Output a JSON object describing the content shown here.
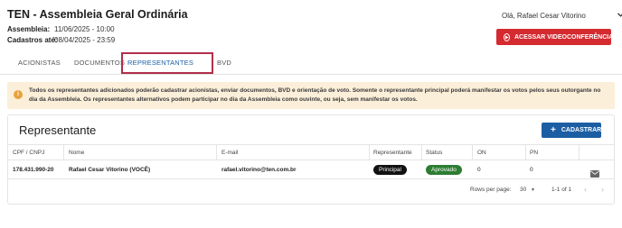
{
  "header": {
    "title": "TEN - Assembleia Geral Ordinária",
    "assembly_label": "Assembleia:",
    "assembly_value": "11/06/2025 - 10:00",
    "registrations_label": "Cadastros até:",
    "registrations_value": "08/04/2025 - 23:59",
    "greeting": "Olá, Rafael Cesar Vitorino",
    "video_button": "ACESSAR VIDEOCONFERÊNCIA"
  },
  "tabs": [
    {
      "label": "ACIONISTAS",
      "active": false
    },
    {
      "label": "DOCUMENTOS",
      "active": false
    },
    {
      "label": "REPRESENTANTES",
      "active": true
    },
    {
      "label": "BVD",
      "active": false
    }
  ],
  "banner": {
    "icon": "info-icon",
    "text": "Todos os representantes adicionados poderão cadastrar acionistas, enviar documentos, BVD e orientação de voto. Somente o representante principal poderá manifestar os votos pelos seus outorgante no dia da Assembleia. Os representantes alternativos podem participar no dia da Assembleia como ouvinte, ou seja, sem manifestar os votos."
  },
  "card": {
    "title": "Representante",
    "add_button": "CADASTRAR"
  },
  "table": {
    "columns": [
      "CPF / CNPJ",
      "Nome",
      "E-mail",
      "Representante",
      "Status",
      "ON",
      "PN"
    ],
    "rows": [
      {
        "cpf": "178.431.990-20",
        "name": "Rafael Cesar Vitorino (VOCÊ)",
        "email": "rafael.vitorino@ten.com.br",
        "role": "Principal",
        "status": "Aprovado",
        "on": "0",
        "pn": "0"
      }
    ]
  },
  "pagination": {
    "rows_per_page_label": "Rows per page:",
    "rows_per_page_value": "30",
    "range": "1-1 of 1"
  },
  "colors": {
    "accent_blue": "#1c5ea3",
    "video_red": "#d42a30",
    "banner_bg": "#fcefd9",
    "status_green": "#2e7d32"
  }
}
